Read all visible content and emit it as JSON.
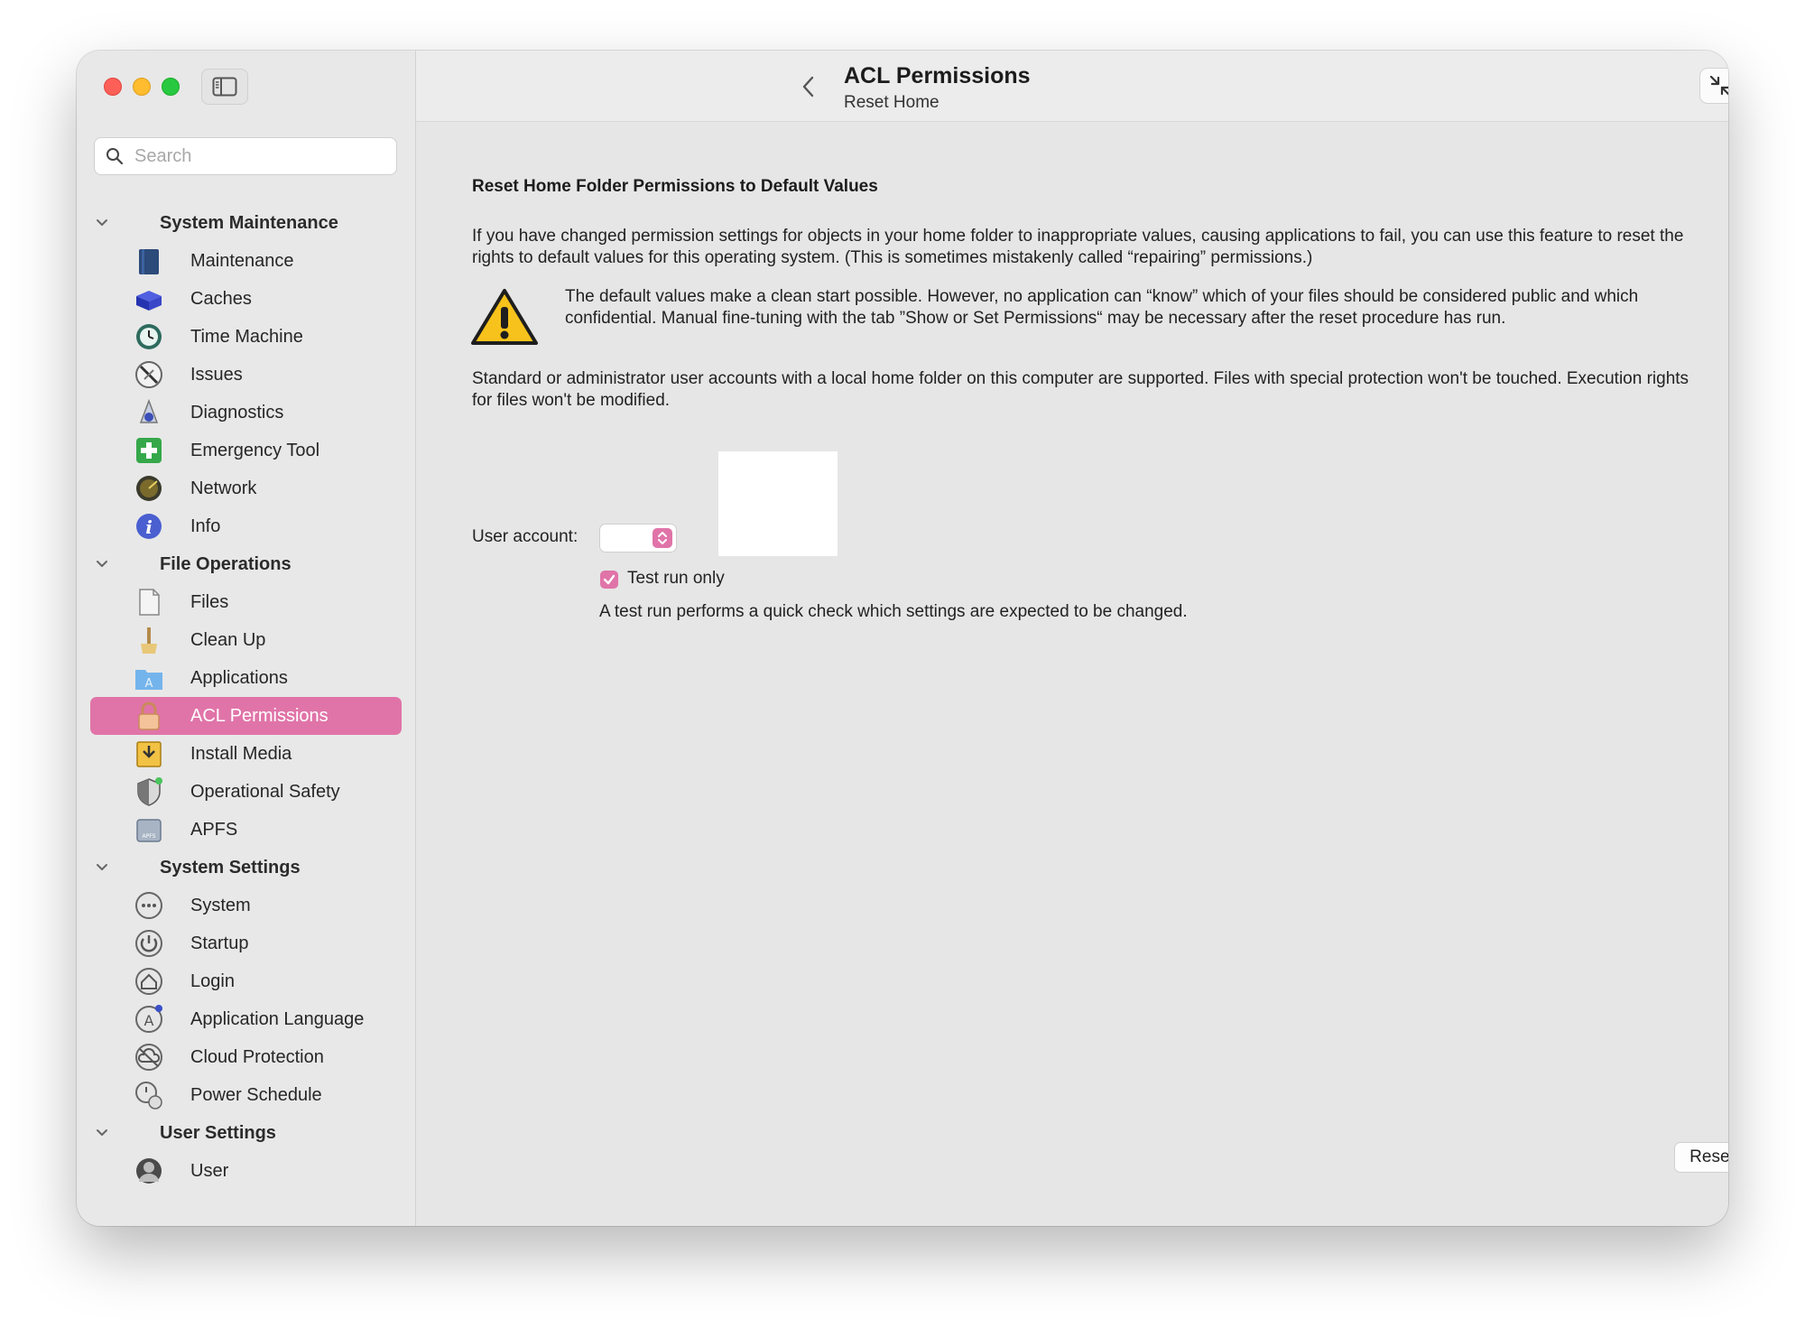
{
  "search": {
    "placeholder": "Search"
  },
  "sidebar": {
    "groups": [
      {
        "title": "System Maintenance",
        "items": [
          {
            "label": "Maintenance",
            "icon": "maintenance-icon"
          },
          {
            "label": "Caches",
            "icon": "caches-icon"
          },
          {
            "label": "Time Machine",
            "icon": "time-machine-icon"
          },
          {
            "label": "Issues",
            "icon": "issues-icon"
          },
          {
            "label": "Diagnostics",
            "icon": "diagnostics-icon"
          },
          {
            "label": "Emergency Tool",
            "icon": "emergency-tool-icon"
          },
          {
            "label": "Network",
            "icon": "network-icon"
          },
          {
            "label": "Info",
            "icon": "info-icon"
          }
        ]
      },
      {
        "title": "File Operations",
        "items": [
          {
            "label": "Files",
            "icon": "files-icon"
          },
          {
            "label": "Clean Up",
            "icon": "clean-up-icon"
          },
          {
            "label": "Applications",
            "icon": "applications-icon"
          },
          {
            "label": "ACL Permissions",
            "icon": "lock-icon",
            "selected": true
          },
          {
            "label": "Install Media",
            "icon": "install-media-icon"
          },
          {
            "label": "Operational Safety",
            "icon": "shield-icon"
          },
          {
            "label": "APFS",
            "icon": "apfs-disk-icon"
          }
        ]
      },
      {
        "title": "System Settings",
        "items": [
          {
            "label": "System",
            "icon": "system-icon"
          },
          {
            "label": "Startup",
            "icon": "power-icon"
          },
          {
            "label": "Login",
            "icon": "home-icon"
          },
          {
            "label": "Application Language",
            "icon": "language-icon"
          },
          {
            "label": "Cloud Protection",
            "icon": "cloud-icon"
          },
          {
            "label": "Power Schedule",
            "icon": "schedule-icon"
          }
        ]
      },
      {
        "title": "User Settings",
        "items": [
          {
            "label": "User",
            "icon": "user-icon"
          }
        ]
      }
    ]
  },
  "header": {
    "title": "ACL Permissions",
    "subtitle": "Reset Home"
  },
  "main": {
    "heading": "Reset Home Folder Permissions to Default Values",
    "paragraph1": "If you have changed permission settings for objects in your home folder to inappropriate values, causing applications to fail, you can use this feature to reset the rights to default values for this operating system. (This is sometimes mistakenly called “repairing” permissions.)",
    "warning": "The default values make a clean start possible. However, no application can “know” which of your files should be considered public and which confidential. Manual fine-tuning with the tab ”Show or Set Permissions“ may be necessary after the reset procedure has run.",
    "paragraph2": "Standard or administrator user accounts with a local home folder on this computer are supported. Files with special protection won't be touched. Execution rights for files won't be modified.",
    "user_account_label": "User account:",
    "user_account_value": "",
    "test_run_label": "Test run only",
    "test_run_checked": true,
    "test_run_note": "A test run performs a quick check which settings are expected to be changed.",
    "reset_label": "Reset"
  },
  "colors": {
    "accent": "#e074a8",
    "warning": "#f7c21b"
  }
}
